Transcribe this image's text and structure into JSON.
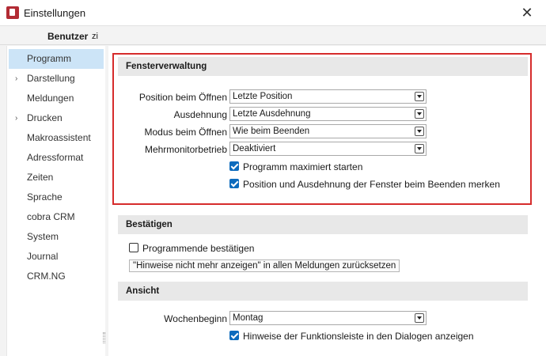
{
  "window": {
    "title": "Einstellungen",
    "close_glyph": "✕"
  },
  "toolbar": {
    "label": "Benutzer",
    "extra": "zi"
  },
  "sidebar": {
    "items": [
      {
        "label": "Programm",
        "chevron": ""
      },
      {
        "label": "Darstellung",
        "chevron": "›"
      },
      {
        "label": "Meldungen",
        "chevron": ""
      },
      {
        "label": "Drucken",
        "chevron": "›"
      },
      {
        "label": "Makroassistent",
        "chevron": ""
      },
      {
        "label": "Adressformat",
        "chevron": ""
      },
      {
        "label": "Zeiten",
        "chevron": ""
      },
      {
        "label": "Sprache",
        "chevron": ""
      },
      {
        "label": "cobra CRM",
        "chevron": ""
      },
      {
        "label": "System",
        "chevron": ""
      },
      {
        "label": "Journal",
        "chevron": ""
      },
      {
        "label": "CRM.NG",
        "chevron": ""
      }
    ],
    "selected": "Programm"
  },
  "fensterverwaltung": {
    "heading": "Fensterverwaltung",
    "fields": [
      {
        "label": "Position beim Öffnen",
        "value": "Letzte Position"
      },
      {
        "label": "Ausdehnung",
        "value": "Letzte Ausdehnung"
      },
      {
        "label": "Modus beim Öffnen",
        "value": "Wie beim Beenden"
      },
      {
        "label": "Mehrmonitorbetrieb",
        "value": "Deaktiviert"
      }
    ],
    "checkboxes": [
      {
        "label": "Programm maximiert starten",
        "checked": true
      },
      {
        "label": "Position und Ausdehnung der Fenster beim Beenden merken",
        "checked": true
      }
    ]
  },
  "bestaetigen": {
    "heading": "Bestätigen",
    "checkbox": {
      "label": "Programmende bestätigen",
      "checked": false
    },
    "reset_button": "\"Hinweise nicht mehr anzeigen\" in allen Meldungen zurücksetzen"
  },
  "ansicht": {
    "heading": "Ansicht",
    "field": {
      "label": "Wochenbeginn",
      "value": "Montag"
    },
    "checkbox": {
      "label": "Hinweise der Funktionsleiste in den Dialogen anzeigen",
      "checked": true
    }
  },
  "colors": {
    "accent": "#0d6bbd",
    "selection": "#cce4f7",
    "highlight_border": "#d62c2c",
    "app_icon": "#b22b34"
  }
}
